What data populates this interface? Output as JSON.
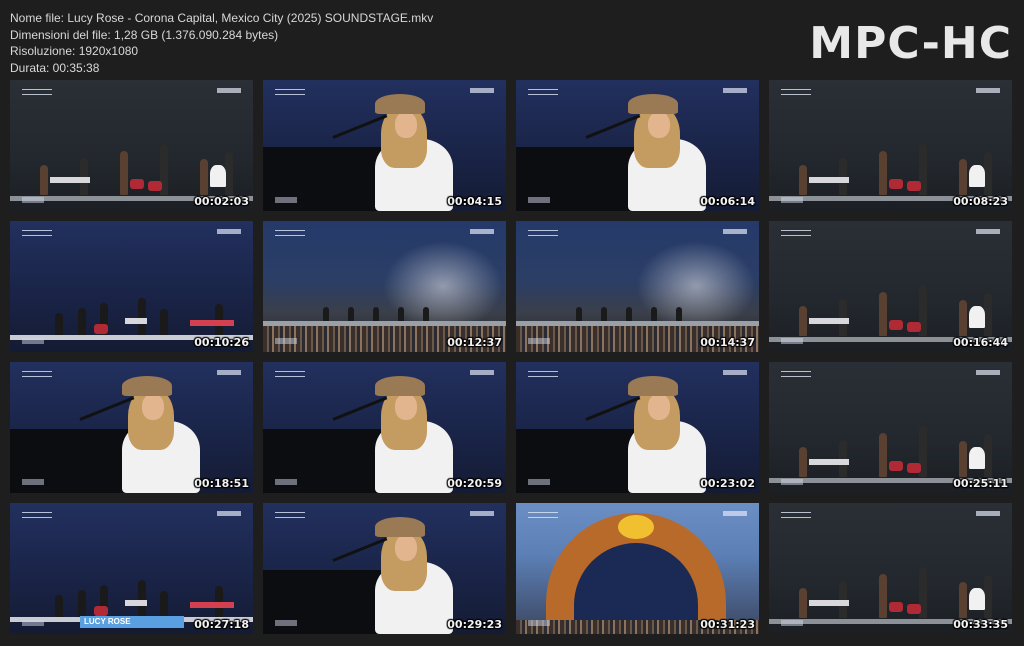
{
  "file_info": {
    "name_line": "Nome file: Lucy Rose - Corona Capital, Mexico City (2025) SOUNDSTAGE.mkv",
    "size_line": "Dimensioni del file: 1,28 GB (1.376.090.284 bytes)",
    "resolution_line": "Risoluzione: 1920x1080",
    "duration_line": "Durata: 00:35:38"
  },
  "logo_text": "MPC-HC",
  "thumbnails": [
    {
      "timestamp": "00:02:03",
      "scene": "dark"
    },
    {
      "timestamp": "00:04:15",
      "scene": "piano"
    },
    {
      "timestamp": "00:06:14",
      "scene": "piano"
    },
    {
      "timestamp": "00:08:23",
      "scene": "dark"
    },
    {
      "timestamp": "00:10:26",
      "scene": "band"
    },
    {
      "timestamp": "00:12:37",
      "scene": "stage"
    },
    {
      "timestamp": "00:14:37",
      "scene": "stage"
    },
    {
      "timestamp": "00:16:44",
      "scene": "dark"
    },
    {
      "timestamp": "00:18:51",
      "scene": "piano"
    },
    {
      "timestamp": "00:20:59",
      "scene": "piano"
    },
    {
      "timestamp": "00:23:02",
      "scene": "piano"
    },
    {
      "timestamp": "00:25:11",
      "scene": "dark"
    },
    {
      "timestamp": "00:27:18",
      "scene": "band",
      "banner": "LUCY ROSE"
    },
    {
      "timestamp": "00:29:23",
      "scene": "piano"
    },
    {
      "timestamp": "00:31:23",
      "scene": "fest"
    },
    {
      "timestamp": "00:33:35",
      "scene": "dark"
    }
  ]
}
